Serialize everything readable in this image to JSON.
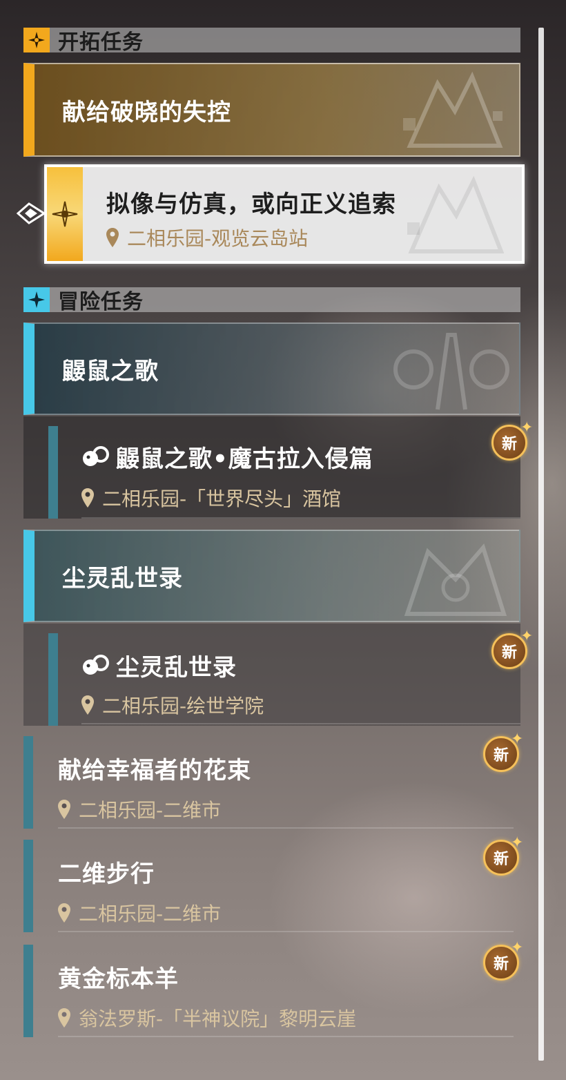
{
  "sections": {
    "trailblaze": {
      "title": "开拓任务",
      "accent": "#f2a81d"
    },
    "adventure": {
      "title": "冒险任务",
      "accent": "#47c8e8"
    }
  },
  "trailblaze_group": {
    "title": "献给破晓的失控"
  },
  "trailblaze_quest": {
    "title": "拟像与仿真，或向正义追索",
    "location": "二相乐园-观览云岛站"
  },
  "groups": [
    {
      "title": "鼹鼠之歌"
    },
    {
      "title": "尘灵乱世录"
    }
  ],
  "quests": [
    {
      "title": "鼹鼠之歌•魔古拉入侵篇",
      "location": "二相乐园-「世界尽头」酒馆",
      "badge": "新"
    },
    {
      "title": "尘灵乱世录",
      "location": "二相乐园-绘世学院",
      "badge": "新"
    },
    {
      "title": "献给幸福者的花束",
      "location": "二相乐园-二维市",
      "badge": "新"
    },
    {
      "title": "二维步行",
      "location": "二相乐园-二维市",
      "badge": "新"
    },
    {
      "title": "黄金标本羊",
      "location": "翁法罗斯-「半神议院」黎明云崖",
      "badge": "新"
    }
  ],
  "icons": {
    "trailblaze": "compass-star-icon",
    "adventure": "four-point-star-icon",
    "location": "map-pin-icon",
    "quest_type": "mole-icon",
    "new_badge": "new-badge-icon",
    "tracking": "tracking-arrow-icon"
  }
}
